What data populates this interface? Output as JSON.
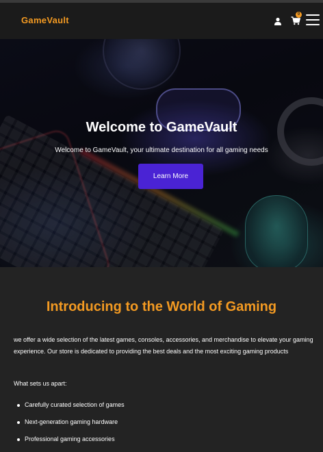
{
  "header": {
    "logo": "GameVault",
    "cart_count": "0",
    "icons": [
      "user-icon",
      "cart-icon",
      "menu-icon"
    ]
  },
  "hero": {
    "title": "Welcome to GameVault",
    "subtitle": "Welcome to GameVault, your ultimate destination for all gaming needs",
    "button_label": "Learn More"
  },
  "intro": {
    "title": "Introducing to the World of Gaming",
    "paragraph": "we offer a wide selection of the latest games, consoles, accessories, and merchandise to elevate your gaming experience. Our store is dedicated to providing the best deals and the most exciting gaming products",
    "apart_label": "What sets us apart:",
    "features": [
      "Carefully curated selection of games",
      "Next-generation gaming hardware",
      "Professional gaming accessories"
    ]
  },
  "colors": {
    "accent": "#f39a22",
    "button": "#4a23d4",
    "header_bg": "#1b1b1b",
    "page_bg": "#232323"
  }
}
